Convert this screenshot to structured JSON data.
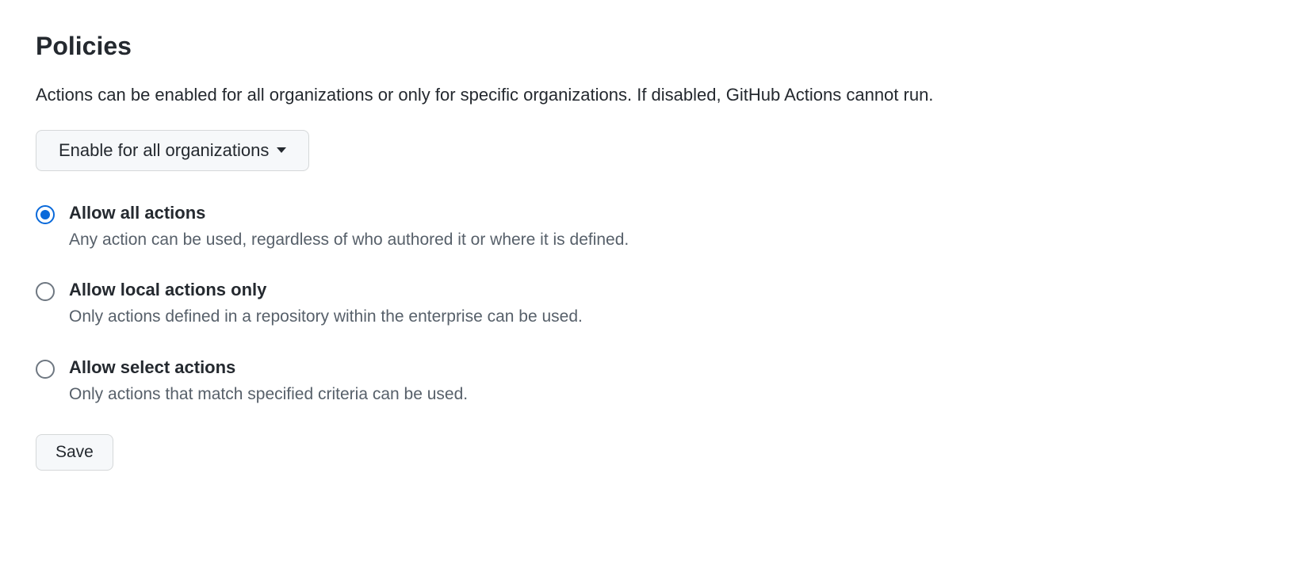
{
  "header": {
    "title": "Policies",
    "description": "Actions can be enabled for all organizations or only for specific organizations. If disabled, GitHub Actions cannot run."
  },
  "scope_dropdown": {
    "selected_label": "Enable for all organizations"
  },
  "policy_options": [
    {
      "label": "Allow all actions",
      "description": "Any action can be used, regardless of who authored it or where it is defined.",
      "checked": true
    },
    {
      "label": "Allow local actions only",
      "description": "Only actions defined in a repository within the enterprise can be used.",
      "checked": false
    },
    {
      "label": "Allow select actions",
      "description": "Only actions that match specified criteria can be used.",
      "checked": false
    }
  ],
  "buttons": {
    "save_label": "Save"
  }
}
